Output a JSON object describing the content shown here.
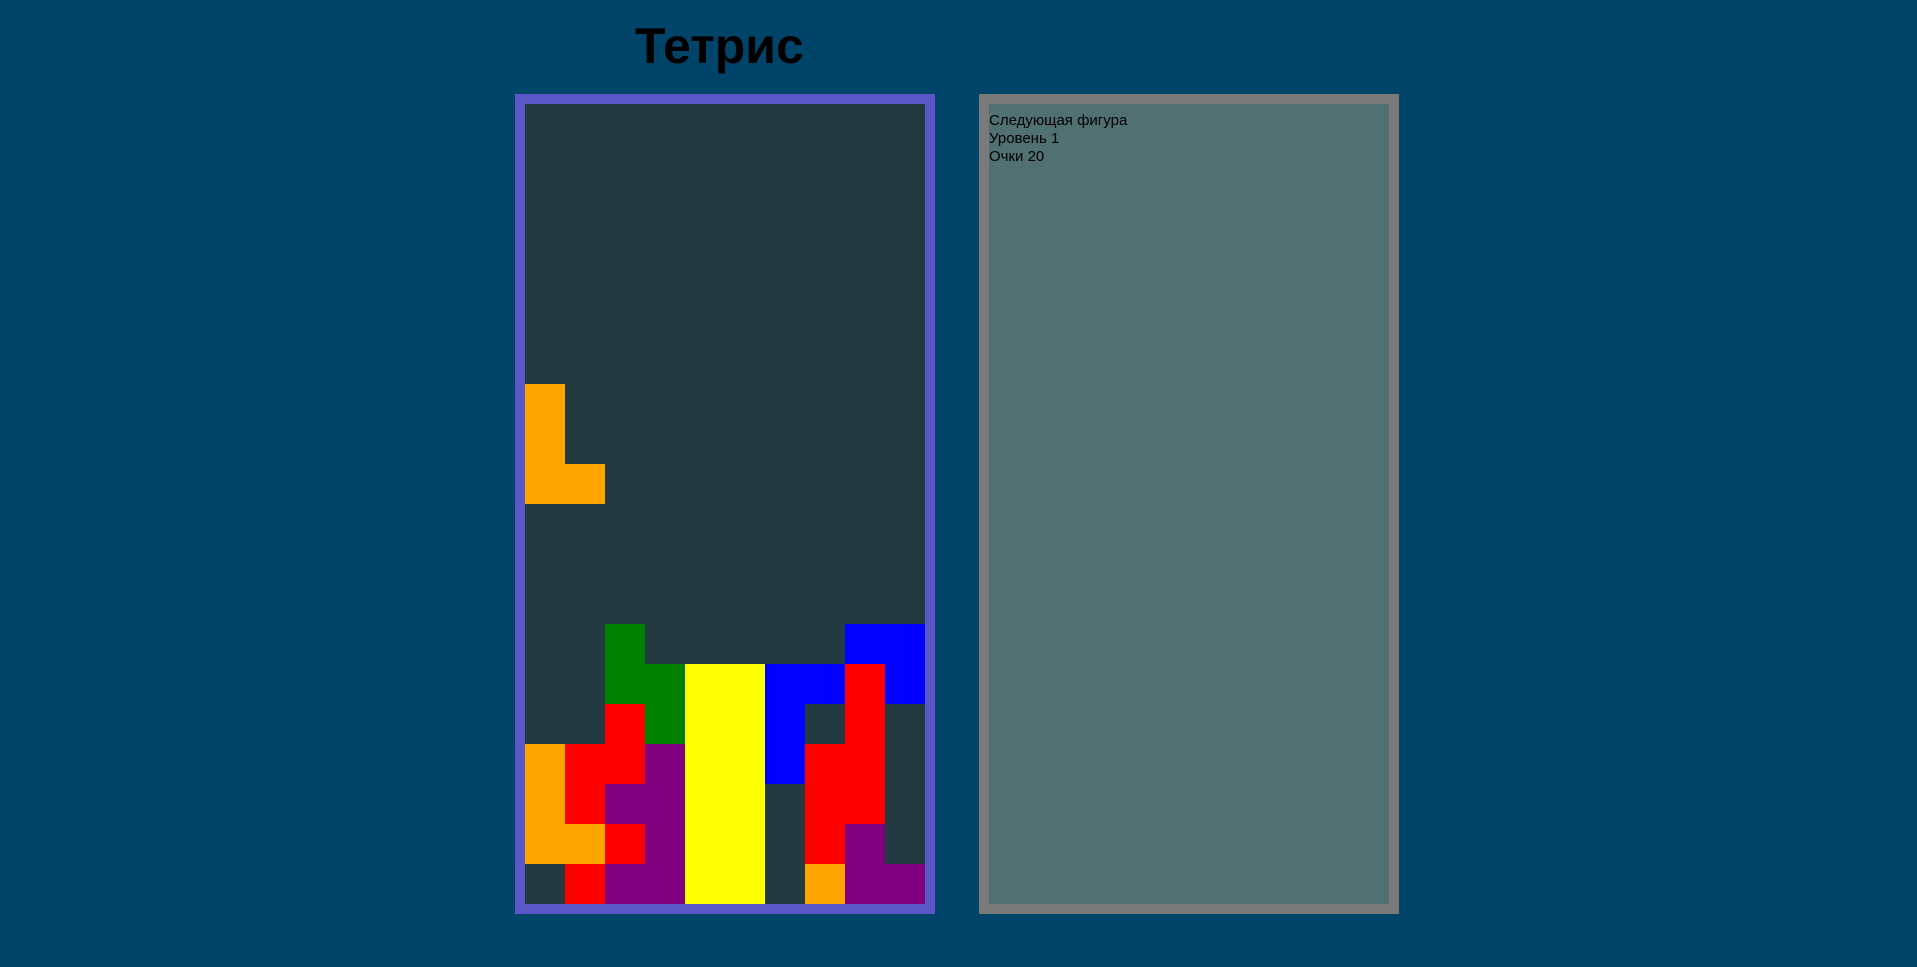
{
  "title": "Тетрис",
  "colors": {
    "background": "#00446A",
    "board_background": "#223A40",
    "board_border": "#5B57C9",
    "side_background": "#507072",
    "side_border": "#7A7A7A",
    "pieces": {
      "O": "#FFA500",
      "R": "#FF0000",
      "G": "#008000",
      "Y": "#FFFF00",
      "B": "#0000FF",
      "P": "#800080"
    }
  },
  "board": {
    "columns": 10,
    "rows": 20,
    "cells": [
      "..........",
      "..........",
      "..........",
      "..........",
      "..........",
      "..........",
      "..........",
      "O.........",
      "O.........",
      "OO........",
      "..........",
      "..........",
      "..........",
      "..G.....BB",
      "..GGYYBBRB",
      "..RGYYB.R.",
      "ORRPYYBRR.",
      "ORPPYY.RR.",
      "OORPYY.RP.",
      ".RPPYY.OPP"
    ]
  },
  "side_panel": {
    "next_label": "Следующая фигура",
    "level_text": "Уровень 1",
    "score_text": "Очки 20"
  }
}
